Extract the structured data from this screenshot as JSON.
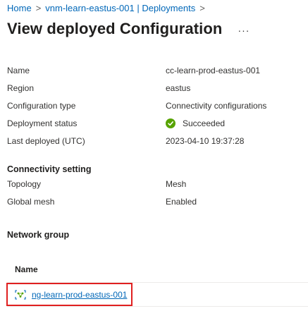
{
  "breadcrumb": {
    "home": "Home",
    "parent": "vnm-learn-eastus-001 | Deployments"
  },
  "header": {
    "title": "View deployed Configuration",
    "more": "···"
  },
  "details": {
    "name_label": "Name",
    "name_value": "cc-learn-prod-eastus-001",
    "region_label": "Region",
    "region_value": "eastus",
    "config_type_label": "Configuration type",
    "config_type_value": "Connectivity configurations",
    "status_label": "Deployment status",
    "status_value": "Succeeded",
    "last_deployed_label": "Last deployed (UTC)",
    "last_deployed_value": "2023-04-10 19:37:28"
  },
  "connectivity": {
    "heading": "Connectivity setting",
    "topology_label": "Topology",
    "topology_value": "Mesh",
    "global_mesh_label": "Global mesh",
    "global_mesh_value": "Enabled"
  },
  "network_group": {
    "heading": "Network group",
    "column_name": "Name",
    "items": [
      {
        "name": "ng-learn-prod-eastus-001"
      }
    ]
  },
  "colors": {
    "link": "#0067b8",
    "success": "#57a300",
    "highlight": "#e02020"
  },
  "icons": {
    "status": "check-circle-icon",
    "network_group": "network-group-icon",
    "chevron": "chevron-right-icon"
  }
}
